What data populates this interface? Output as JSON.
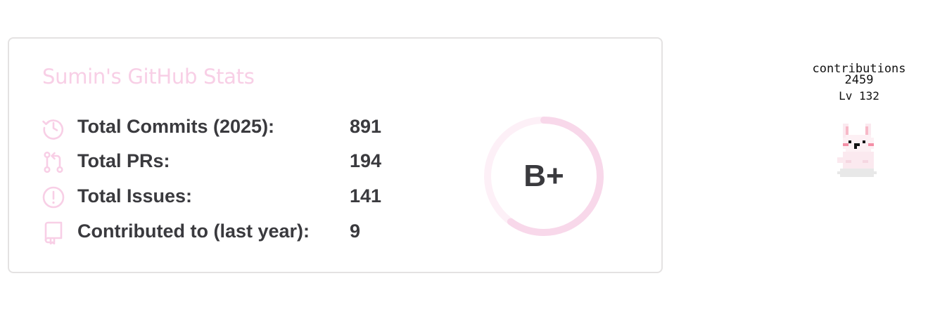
{
  "card": {
    "title": "Sumin's GitHub Stats",
    "accent_color": "#f8cfe6",
    "text_color": "#3a3a3e",
    "border_color": "#e4e2e2",
    "stats": [
      {
        "icon": "history-icon",
        "label": "Total Commits (2025):",
        "value": "891"
      },
      {
        "icon": "pull-request-icon",
        "label": "Total PRs:",
        "value": "194"
      },
      {
        "icon": "issue-icon",
        "label": "Total Issues:",
        "value": "141"
      },
      {
        "icon": "repo-icon",
        "label": "Contributed to (last year):",
        "value": "9"
      }
    ],
    "rank": {
      "grade": "B+",
      "progress_fraction": 0.6
    }
  },
  "pet": {
    "contributions_label": "contributions",
    "contributions_value": "2459",
    "level": "Lv 132",
    "sprite": "pixel-rabbit-icon"
  }
}
